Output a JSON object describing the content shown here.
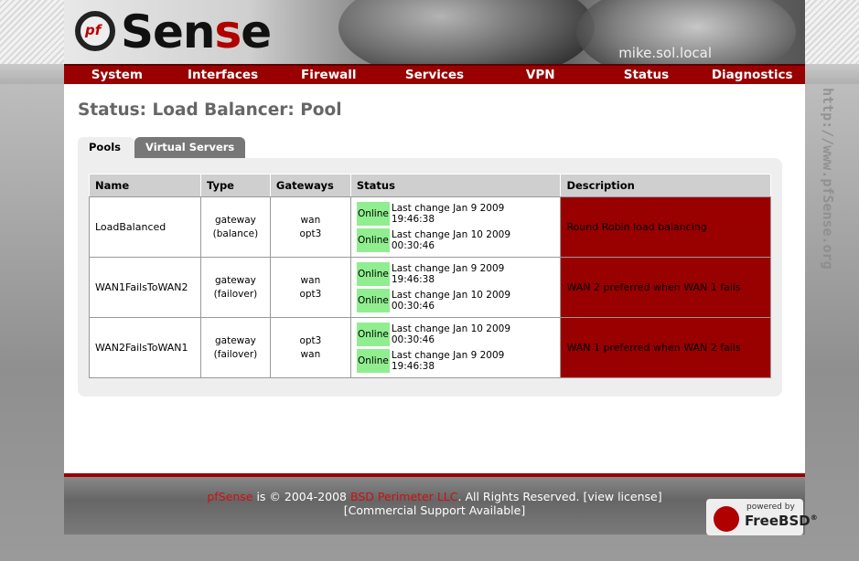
{
  "header": {
    "logo_text_a": "Sen",
    "logo_text_b": "s",
    "logo_text_c": "e",
    "logo_mark": "pf",
    "hostname": "mike.sol.local"
  },
  "side_url": "http://www.pfSense.org",
  "nav": [
    "System",
    "Interfaces",
    "Firewall",
    "Services",
    "VPN",
    "Status",
    "Diagnostics"
  ],
  "page_title": "Status: Load Balancer: Pool",
  "tabs": [
    {
      "label": "Pools",
      "active": true
    },
    {
      "label": "Virtual Servers",
      "active": false
    }
  ],
  "table": {
    "headers": [
      "Name",
      "Type",
      "Gateways",
      "Status",
      "Description"
    ],
    "rows": [
      {
        "name": "LoadBalanced",
        "type_a": "gateway",
        "type_b": "(balance)",
        "gateways": [
          "wan",
          "opt3"
        ],
        "status": [
          {
            "state": "Online",
            "line1": "Last change Jan 9 2009",
            "line2": "19:46:38"
          },
          {
            "state": "Online",
            "line1": "Last change Jan 10 2009",
            "line2": "00:30:46"
          }
        ],
        "description": "Round Robin load balancing"
      },
      {
        "name": "WAN1FailsToWAN2",
        "type_a": "gateway",
        "type_b": "(failover)",
        "gateways": [
          "wan",
          "opt3"
        ],
        "status": [
          {
            "state": "Online",
            "line1": "Last change Jan 9 2009",
            "line2": "19:46:38"
          },
          {
            "state": "Online",
            "line1": "Last change Jan 10 2009",
            "line2": "00:30:46"
          }
        ],
        "description": "WAN 2 preferred when WAN 1 fails"
      },
      {
        "name": "WAN2FailsToWAN1",
        "type_a": "gateway",
        "type_b": "(failover)",
        "gateways": [
          "opt3",
          "wan"
        ],
        "status": [
          {
            "state": "Online",
            "line1": "Last change Jan 10 2009",
            "line2": "00:30:46"
          },
          {
            "state": "Online",
            "line1": "Last change Jan 9 2009",
            "line2": "19:46:38"
          }
        ],
        "description": "WAN 1 preferred when WAN 2 fails"
      }
    ]
  },
  "footer": {
    "product": "pfSense",
    "copyright": " is © 2004-2008 ",
    "company": "BSD Perimeter LLC",
    "rights": ". All Rights Reserved. [",
    "license": "view license",
    "close": "]",
    "support": "[Commercial Support Available]",
    "badge_small": "powered by",
    "badge_big": "FreeBSD",
    "badge_reg": "®"
  },
  "colors": {
    "nav_bg": "#990000",
    "online_bg": "#90ee90",
    "description_bg": "#990000"
  }
}
